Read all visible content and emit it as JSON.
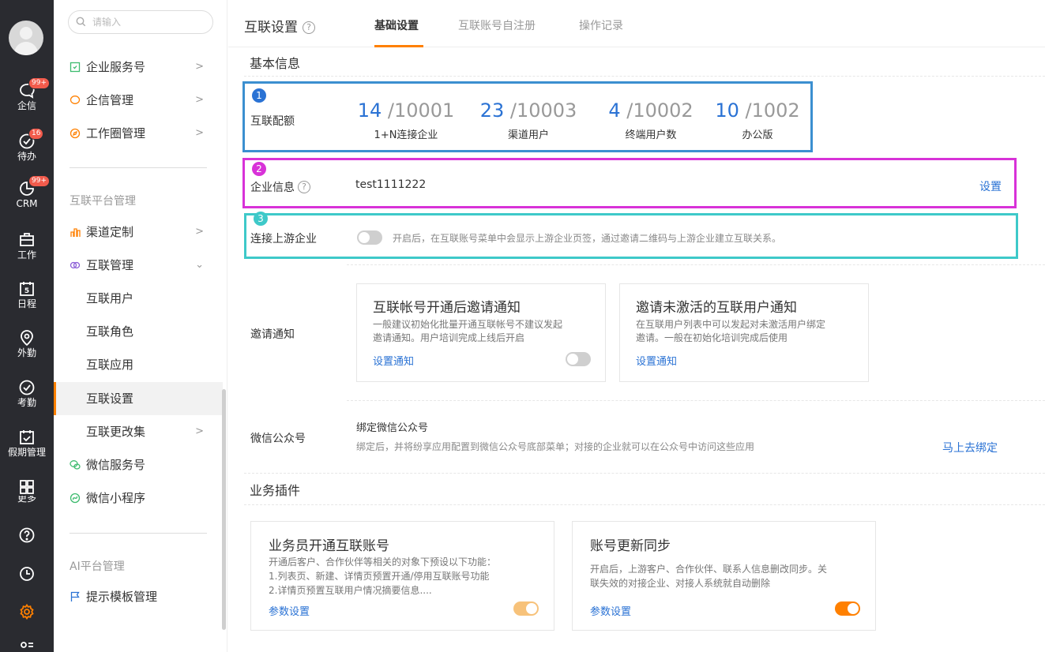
{
  "rail": {
    "items": [
      {
        "label": "企信",
        "badge": "99+",
        "icon": "chat-icon"
      },
      {
        "label": "待办",
        "badge": "16",
        "icon": "check-circle-icon"
      },
      {
        "label": "CRM",
        "badge": "99+",
        "icon": "crm-icon"
      },
      {
        "label": "工作",
        "icon": "briefcase-icon"
      },
      {
        "label": "日程",
        "icon": "calendar-icon",
        "day": "5"
      },
      {
        "label": "外勤",
        "icon": "location-icon"
      },
      {
        "label": "考勤",
        "icon": "attendance-icon"
      },
      {
        "label": "假期管理",
        "icon": "holiday-icon"
      },
      {
        "label": "更多",
        "icon": "grid-icon"
      }
    ]
  },
  "nav": {
    "search_placeholder": "请输入",
    "items_top": [
      {
        "label": "企业服务号",
        "arrow": ">"
      },
      {
        "label": "企信管理",
        "arrow": ">"
      },
      {
        "label": "工作圈管理",
        "arrow": ">"
      }
    ],
    "group1": "互联平台管理",
    "items_group1": [
      {
        "label": "渠道定制",
        "arrow": ">"
      },
      {
        "label": "互联管理",
        "arrow": "⌄"
      }
    ],
    "subitems": [
      {
        "label": "互联用户"
      },
      {
        "label": "互联角色"
      },
      {
        "label": "互联应用"
      },
      {
        "label": "互联设置"
      },
      {
        "label": "互联更改集",
        "arrow": ">"
      }
    ],
    "items_group1b": [
      {
        "label": "微信服务号"
      },
      {
        "label": "微信小程序"
      }
    ],
    "group2": "AI平台管理",
    "items_group2": [
      {
        "label": "提示模板管理"
      }
    ]
  },
  "header": {
    "title": "互联设置",
    "help": "?",
    "tabs": [
      "基础设置",
      "互联账号自注册",
      "操作记录"
    ]
  },
  "basic": {
    "title": "基本信息",
    "quota_label": "互联配额",
    "quotas": [
      {
        "used": "14",
        "total": "/10001",
        "caption": "1+N连接企业"
      },
      {
        "used": "23",
        "total": "/10003",
        "caption": "渠道用户"
      },
      {
        "used": "4",
        "total": "/10002",
        "caption": "终端用户数"
      },
      {
        "used": "10",
        "total": "/1002",
        "caption": "办公版"
      }
    ],
    "company_label": "企业信息",
    "company_value": "test1111222",
    "company_action": "设置",
    "upstream_label": "连接上游企业",
    "upstream_desc": "开启后，在互联账号菜单中会显示上游企业页签，通过邀请二维码与上游企业建立互联关系。",
    "invite_label": "邀请通知",
    "invite_cards": [
      {
        "title": "互联帐号开通后邀请通知",
        "desc1": "一般建议初始化批量开通互联帐号不建议发起",
        "desc2": "邀请通知。用户培训完成上线后开启",
        "link": "设置通知"
      },
      {
        "title": "邀请未激活的互联用户通知",
        "desc1": "在互联用户列表中可以发起对未激活用户绑定",
        "desc2": "邀请。一般在初始化培训完成后使用",
        "link": "设置通知"
      }
    ],
    "wechat_label": "微信公众号",
    "wechat_title": "绑定微信公众号",
    "wechat_desc": "绑定后，并将纷享应用配置到微信公众号底部菜单；对接的企业就可以在公众号中访问这些应用",
    "wechat_action": "马上去绑定"
  },
  "markers": [
    "1",
    "2",
    "3"
  ],
  "plugins": {
    "title": "业务插件",
    "cards": [
      {
        "title": "业务员开通互联账号",
        "desc1": "开通后客户、合作伙伴等相关的对象下预设以下功能：",
        "desc2": "1.列表页、新建、详情页预置开通/停用互联账号功能",
        "desc3": "2.详情页预置互联用户情况摘要信息....",
        "link": "参数设置"
      },
      {
        "title": "账号更新同步",
        "desc1": "开启后，上游客户、合作伙伴、联系人信息删改同步。关",
        "desc2": "联失效的对接企业、对接人系统就自动删除",
        "desc3": "",
        "link": "参数设置"
      }
    ]
  },
  "colors": {
    "accent": "#ff8000",
    "link": "#2a72d4",
    "box1": "#3b8fd0",
    "box2": "#d832d8",
    "box3": "#3ec9c9"
  }
}
